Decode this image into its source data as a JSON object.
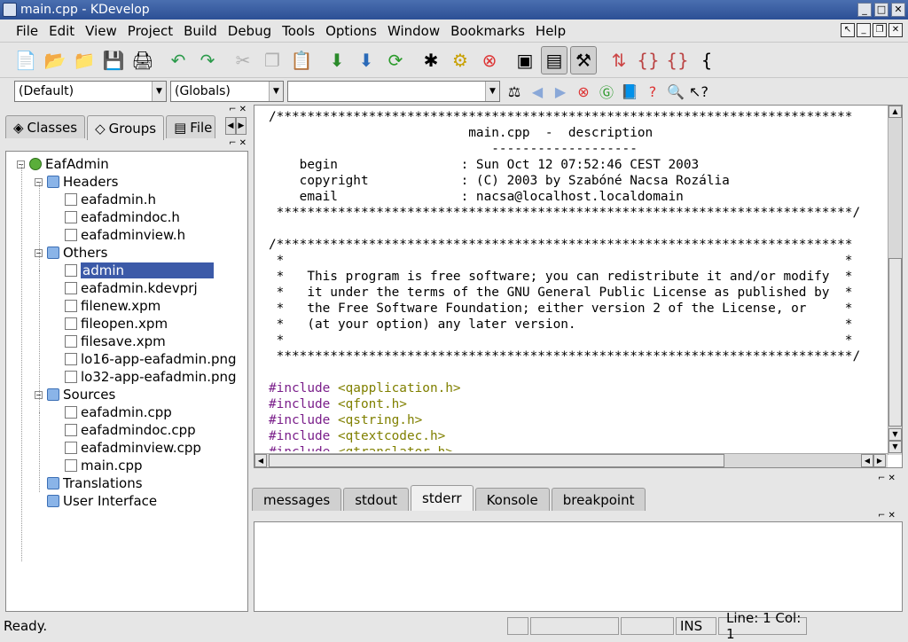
{
  "window": {
    "title": "main.cpp - KDevelop"
  },
  "menu": [
    "File",
    "Edit",
    "View",
    "Project",
    "Build",
    "Debug",
    "Tools",
    "Options",
    "Window",
    "Bookmarks",
    "Help"
  ],
  "toolbar_icons": [
    "new-file-icon",
    "open-project-icon",
    "open-file-icon",
    "save-icon",
    "print-icon",
    "undo-icon",
    "redo-icon",
    "cut-icon",
    "copy-icon",
    "paste-icon",
    "compile-file-icon",
    "build-icon",
    "rebuild-icon",
    "debug-icon",
    "run-icon",
    "stop-icon",
    "qt-designer-icon",
    "tree-view-icon",
    "output-view-icon",
    "sort-icon",
    "brackets-icon",
    "brackets2-icon",
    "grep-icon"
  ],
  "combos": {
    "first": "(Default)",
    "second": "(Globals)",
    "third": ""
  },
  "left_panel": {
    "tabs": [
      "Classes",
      "Groups",
      "File"
    ],
    "tree": [
      {
        "label": "EafAdmin",
        "level": 0,
        "type": "root"
      },
      {
        "label": "Headers",
        "level": 1,
        "type": "folder"
      },
      {
        "label": "eafadmin.h",
        "level": 2,
        "type": "file"
      },
      {
        "label": "eafadmindoc.h",
        "level": 2,
        "type": "file"
      },
      {
        "label": "eafadminview.h",
        "level": 2,
        "type": "file"
      },
      {
        "label": "Others",
        "level": 1,
        "type": "folder"
      },
      {
        "label": "admin",
        "level": 2,
        "type": "file",
        "selected": true
      },
      {
        "label": "eafadmin.kdevprj",
        "level": 2,
        "type": "file"
      },
      {
        "label": "filenew.xpm",
        "level": 2,
        "type": "file"
      },
      {
        "label": "fileopen.xpm",
        "level": 2,
        "type": "file"
      },
      {
        "label": "filesave.xpm",
        "level": 2,
        "type": "file"
      },
      {
        "label": "lo16-app-eafadmin.png",
        "level": 2,
        "type": "file"
      },
      {
        "label": "lo32-app-eafadmin.png",
        "level": 2,
        "type": "file"
      },
      {
        "label": "Sources",
        "level": 1,
        "type": "folder"
      },
      {
        "label": "eafadmin.cpp",
        "level": 2,
        "type": "file"
      },
      {
        "label": "eafadmindoc.cpp",
        "level": 2,
        "type": "file"
      },
      {
        "label": "eafadminview.cpp",
        "level": 2,
        "type": "file"
      },
      {
        "label": "main.cpp",
        "level": 2,
        "type": "file"
      },
      {
        "label": "Translations",
        "level": 1,
        "type": "folder"
      },
      {
        "label": "User Interface",
        "level": 1,
        "type": "folder"
      }
    ]
  },
  "editor": {
    "lines": [
      {
        "t": "/***************************************************************************",
        "c": "cm"
      },
      {
        "t": "                          main.cpp  -  description",
        "c": "cm"
      },
      {
        "t": "                             -------------------",
        "c": "cm"
      },
      {
        "t": "    begin                : Sun Oct 12 07:52:46 CEST 2003",
        "c": "cm"
      },
      {
        "t": "    copyright            : (C) 2003 by Szabóné Nacsa Rozália",
        "c": "cm"
      },
      {
        "t": "    email                : nacsa@localhost.localdomain",
        "c": "cm"
      },
      {
        "t": " ***************************************************************************/",
        "c": "cm"
      },
      {
        "t": "",
        "c": "cm"
      },
      {
        "t": "/***************************************************************************",
        "c": "cm"
      },
      {
        "t": " *                                                                         *",
        "c": "cm"
      },
      {
        "t": " *   This program is free software; you can redistribute it and/or modify  *",
        "c": "cm"
      },
      {
        "t": " *   it under the terms of the GNU General Public License as published by  *",
        "c": "cm"
      },
      {
        "t": " *   the Free Software Foundation; either version 2 of the License, or     *",
        "c": "cm"
      },
      {
        "t": " *   (at your option) any later version.                                   *",
        "c": "cm"
      },
      {
        "t": " *                                                                         *",
        "c": "cm"
      },
      {
        "t": " ***************************************************************************/",
        "c": "cm"
      },
      {
        "t": "",
        "c": "cm"
      },
      {
        "kw": "#include",
        "str": " <qapplication.h>"
      },
      {
        "kw": "#include",
        "str": " <qfont.h>"
      },
      {
        "kw": "#include",
        "str": " <qstring.h>"
      },
      {
        "kw": "#include",
        "str": " <qtextcodec.h>"
      },
      {
        "kw": "#include",
        "str": " <qtranslator.h>"
      }
    ]
  },
  "output_tabs": [
    "messages",
    "stdout",
    "stderr",
    "Konsole",
    "breakpoint"
  ],
  "output_active": "stderr",
  "status": {
    "message": "Ready.",
    "mode": "INS",
    "position": "Line: 1 Col: 1"
  }
}
